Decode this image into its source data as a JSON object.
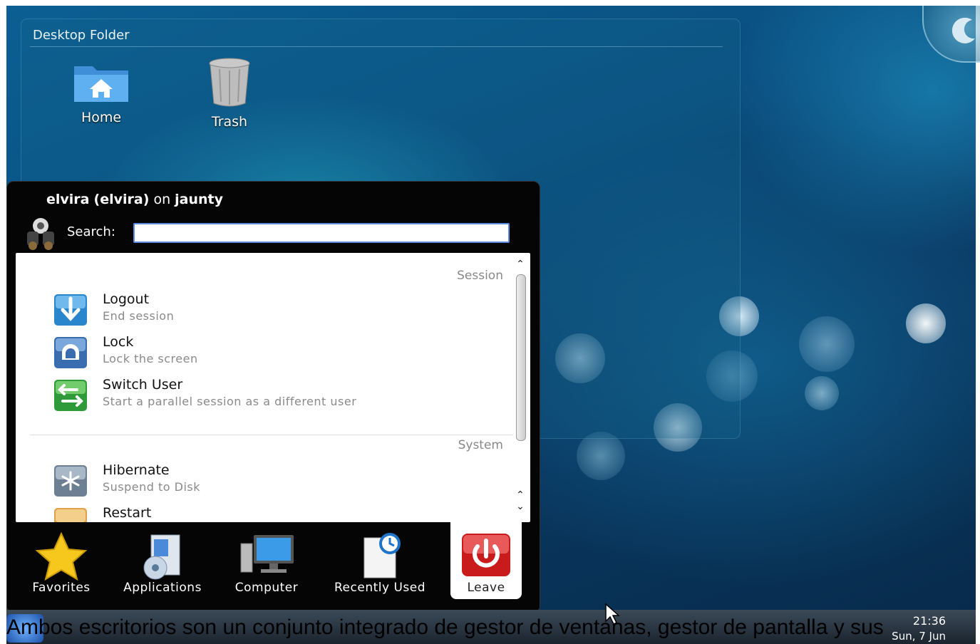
{
  "desktop": {
    "folder_title": "Desktop Folder",
    "icons": [
      {
        "label": "Home",
        "icon": "home-folder-icon"
      },
      {
        "label": "Trash",
        "icon": "trash-icon"
      }
    ]
  },
  "launcher": {
    "user": "elvira",
    "user_full": "(elvira)",
    "on_word": "on",
    "host": "jaunty",
    "search": {
      "label": "Search:",
      "placeholder": "",
      "value": ""
    },
    "sections": [
      {
        "title": "Session",
        "items": [
          {
            "name": "Logout",
            "desc": "End session",
            "icon": "logout-icon"
          },
          {
            "name": "Lock",
            "desc": "Lock the screen",
            "icon": "lock-icon"
          },
          {
            "name": "Switch User",
            "desc": "Start a parallel session as a different user",
            "icon": "switch-user-icon"
          }
        ]
      },
      {
        "title": "System",
        "items": [
          {
            "name": "Hibernate",
            "desc": "Suspend to Disk",
            "icon": "hibernate-icon"
          },
          {
            "name": "Restart",
            "desc": "",
            "icon": "restart-icon"
          }
        ]
      }
    ],
    "tabs": [
      {
        "label": "Favorites",
        "icon": "star-icon"
      },
      {
        "label": "Applications",
        "icon": "applications-icon"
      },
      {
        "label": "Computer",
        "icon": "computer-icon"
      },
      {
        "label": "Recently Used",
        "icon": "recently-used-icon"
      },
      {
        "label": "Leave",
        "icon": "power-icon",
        "active": true
      }
    ]
  },
  "taskbar": {
    "time": "21:36",
    "date": "Sun, 7 Jun"
  },
  "caption": "Ambos escritorios son un conjunto integrado de gestor de ventanas, gestor de pantalla y sus"
}
